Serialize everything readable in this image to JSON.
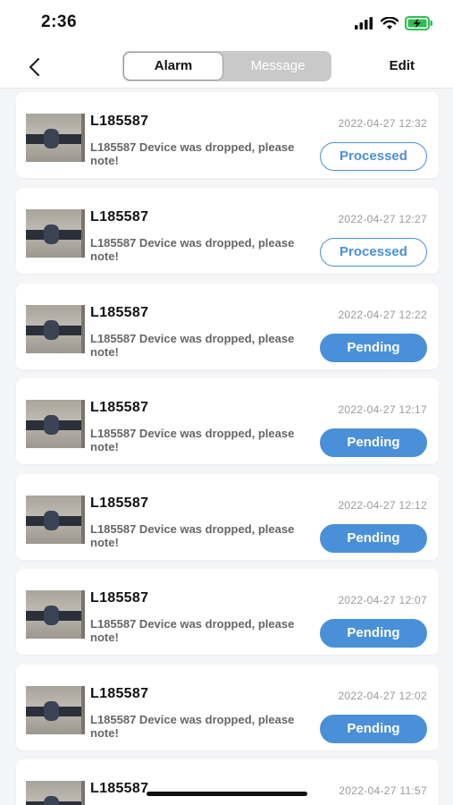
{
  "status_bar": {
    "time": "2:36"
  },
  "nav": {
    "tabs": [
      {
        "label": "Alarm",
        "active": true
      },
      {
        "label": "Message",
        "active": false
      }
    ],
    "edit_label": "Edit"
  },
  "colors": {
    "accent": "#4a90d9",
    "background": "#f4f5f7"
  },
  "alarms": [
    {
      "device": "L185587",
      "time": "2022-04-27 12:32",
      "message": "L185587 Device was dropped, please note!",
      "status": "Processed"
    },
    {
      "device": "L185587",
      "time": "2022-04-27 12:27",
      "message": "L185587 Device was dropped, please note!",
      "status": "Processed"
    },
    {
      "device": "L185587",
      "time": "2022-04-27 12:22",
      "message": "L185587 Device was dropped, please note!",
      "status": "Pending"
    },
    {
      "device": "L185587",
      "time": "2022-04-27 12:17",
      "message": "L185587 Device was dropped, please note!",
      "status": "Pending"
    },
    {
      "device": "L185587",
      "time": "2022-04-27 12:12",
      "message": "L185587 Device was dropped, please note!",
      "status": "Pending"
    },
    {
      "device": "L185587",
      "time": "2022-04-27 12:07",
      "message": "L185587 Device was dropped, please note!",
      "status": "Pending"
    },
    {
      "device": "L185587",
      "time": "2022-04-27 12:02",
      "message": "L185587 Device was dropped, please note!",
      "status": "Pending"
    },
    {
      "device": "L185587",
      "time": "2022-04-27 11:57",
      "message": "",
      "status": ""
    }
  ]
}
